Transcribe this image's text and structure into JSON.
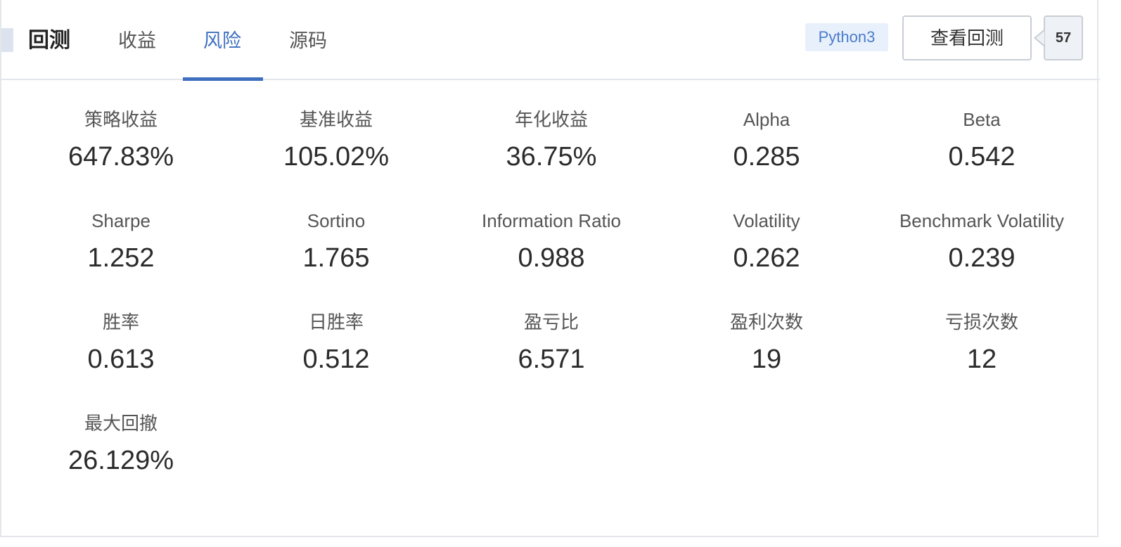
{
  "header": {
    "title": "回测",
    "tabs": [
      {
        "label": "收益",
        "active": false
      },
      {
        "label": "风险",
        "active": true
      },
      {
        "label": "源码",
        "active": false
      }
    ],
    "language_badge": "Python3",
    "view_button_label": "查看回测",
    "count": "57"
  },
  "colors": {
    "accent": "#3e6fbf",
    "badge_bg": "#e8f0fb",
    "badge_text": "#4a7ccc"
  },
  "stats": [
    {
      "label": "策略收益",
      "value": "647.83%"
    },
    {
      "label": "基准收益",
      "value": "105.02%"
    },
    {
      "label": "年化收益",
      "value": "36.75%"
    },
    {
      "label": "Alpha",
      "value": "0.285"
    },
    {
      "label": "Beta",
      "value": "0.542"
    },
    {
      "label": "Sharpe",
      "value": "1.252"
    },
    {
      "label": "Sortino",
      "value": "1.765"
    },
    {
      "label": "Information Ratio",
      "value": "0.988"
    },
    {
      "label": "Volatility",
      "value": "0.262"
    },
    {
      "label": "Benchmark Volatility",
      "value": "0.239"
    },
    {
      "label": "胜率",
      "value": "0.613"
    },
    {
      "label": "日胜率",
      "value": "0.512"
    },
    {
      "label": "盈亏比",
      "value": "6.571"
    },
    {
      "label": "盈利次数",
      "value": "19"
    },
    {
      "label": "亏损次数",
      "value": "12"
    },
    {
      "label": "最大回撤",
      "value": "26.129%"
    }
  ]
}
